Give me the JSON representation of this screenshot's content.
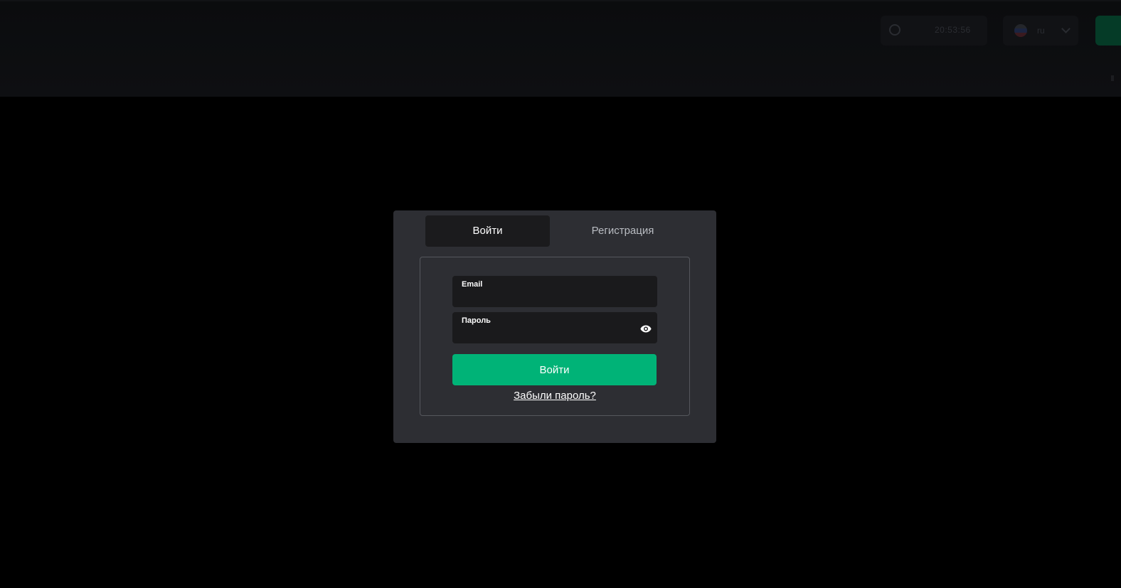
{
  "header": {
    "clock_text": "20:53:56",
    "language_code": "ru"
  },
  "modal": {
    "tabs": [
      {
        "label": "Войти",
        "active": true
      },
      {
        "label": "Регистрация",
        "active": false
      }
    ],
    "email": {
      "label": "Email",
      "value": ""
    },
    "password": {
      "label": "Пароль",
      "value": "",
      "toggle_icon": "eye-icon"
    },
    "submit_label": "Войти",
    "forgot_link": "Забыли пароль?"
  },
  "colors": {
    "background": "#000000",
    "modal_bg": "#2d2e33",
    "field_bg": "#1a1a1c",
    "active_tab_bg": "#1b1b1d",
    "accent_green": "#00b377",
    "panel_border": "#55575d"
  }
}
